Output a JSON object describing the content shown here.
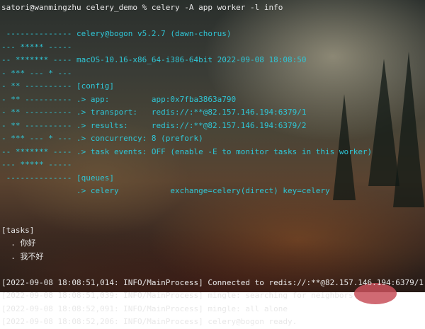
{
  "terminal": {
    "prompt": "satori@wanmingzhu celery_demo % celery -A app worker -l info",
    "banner": [
      " -------------- celery@bogon v5.2.7 (dawn-chorus)",
      "--- ***** -----",
      "-- ******* ---- macOS-10.16-x86_64-i386-64bit 2022-09-08 18:08:50",
      "- *** --- * ---",
      "- ** ---------- [config]",
      "- ** ---------- .> app:         app:0x7fba3863a790",
      "- ** ---------- .> transport:   redis://:**@82.157.146.194:6379/1",
      "- ** ---------- .> results:     redis://:**@82.157.146.194:6379/2",
      "- *** --- * --- .> concurrency: 8 (prefork)",
      "-- ******* ---- .> task events: OFF (enable -E to monitor tasks in this worker)",
      "--- ***** -----",
      " -------------- [queues]",
      "                .> celery           exchange=celery(direct) key=celery"
    ],
    "tasks_header": "[tasks]",
    "tasks": [
      "  . 你好",
      "  . 我不好"
    ],
    "logs": [
      "[2022-09-08 18:08:51,014: INFO/MainProcess] Connected to redis://:**@82.157.146.194:6379/1",
      "[2022-09-08 18:08:51,039: INFO/MainProcess] mingle: searching for neighbors",
      "[2022-09-08 18:08:52,091: INFO/MainProcess] mingle: all alone",
      "[2022-09-08 18:08:52,206: INFO/MainProcess] celery@bogon ready."
    ]
  },
  "colors": {
    "banner_text": "#2fc6d6",
    "plain_text": "#e8e8e8"
  }
}
